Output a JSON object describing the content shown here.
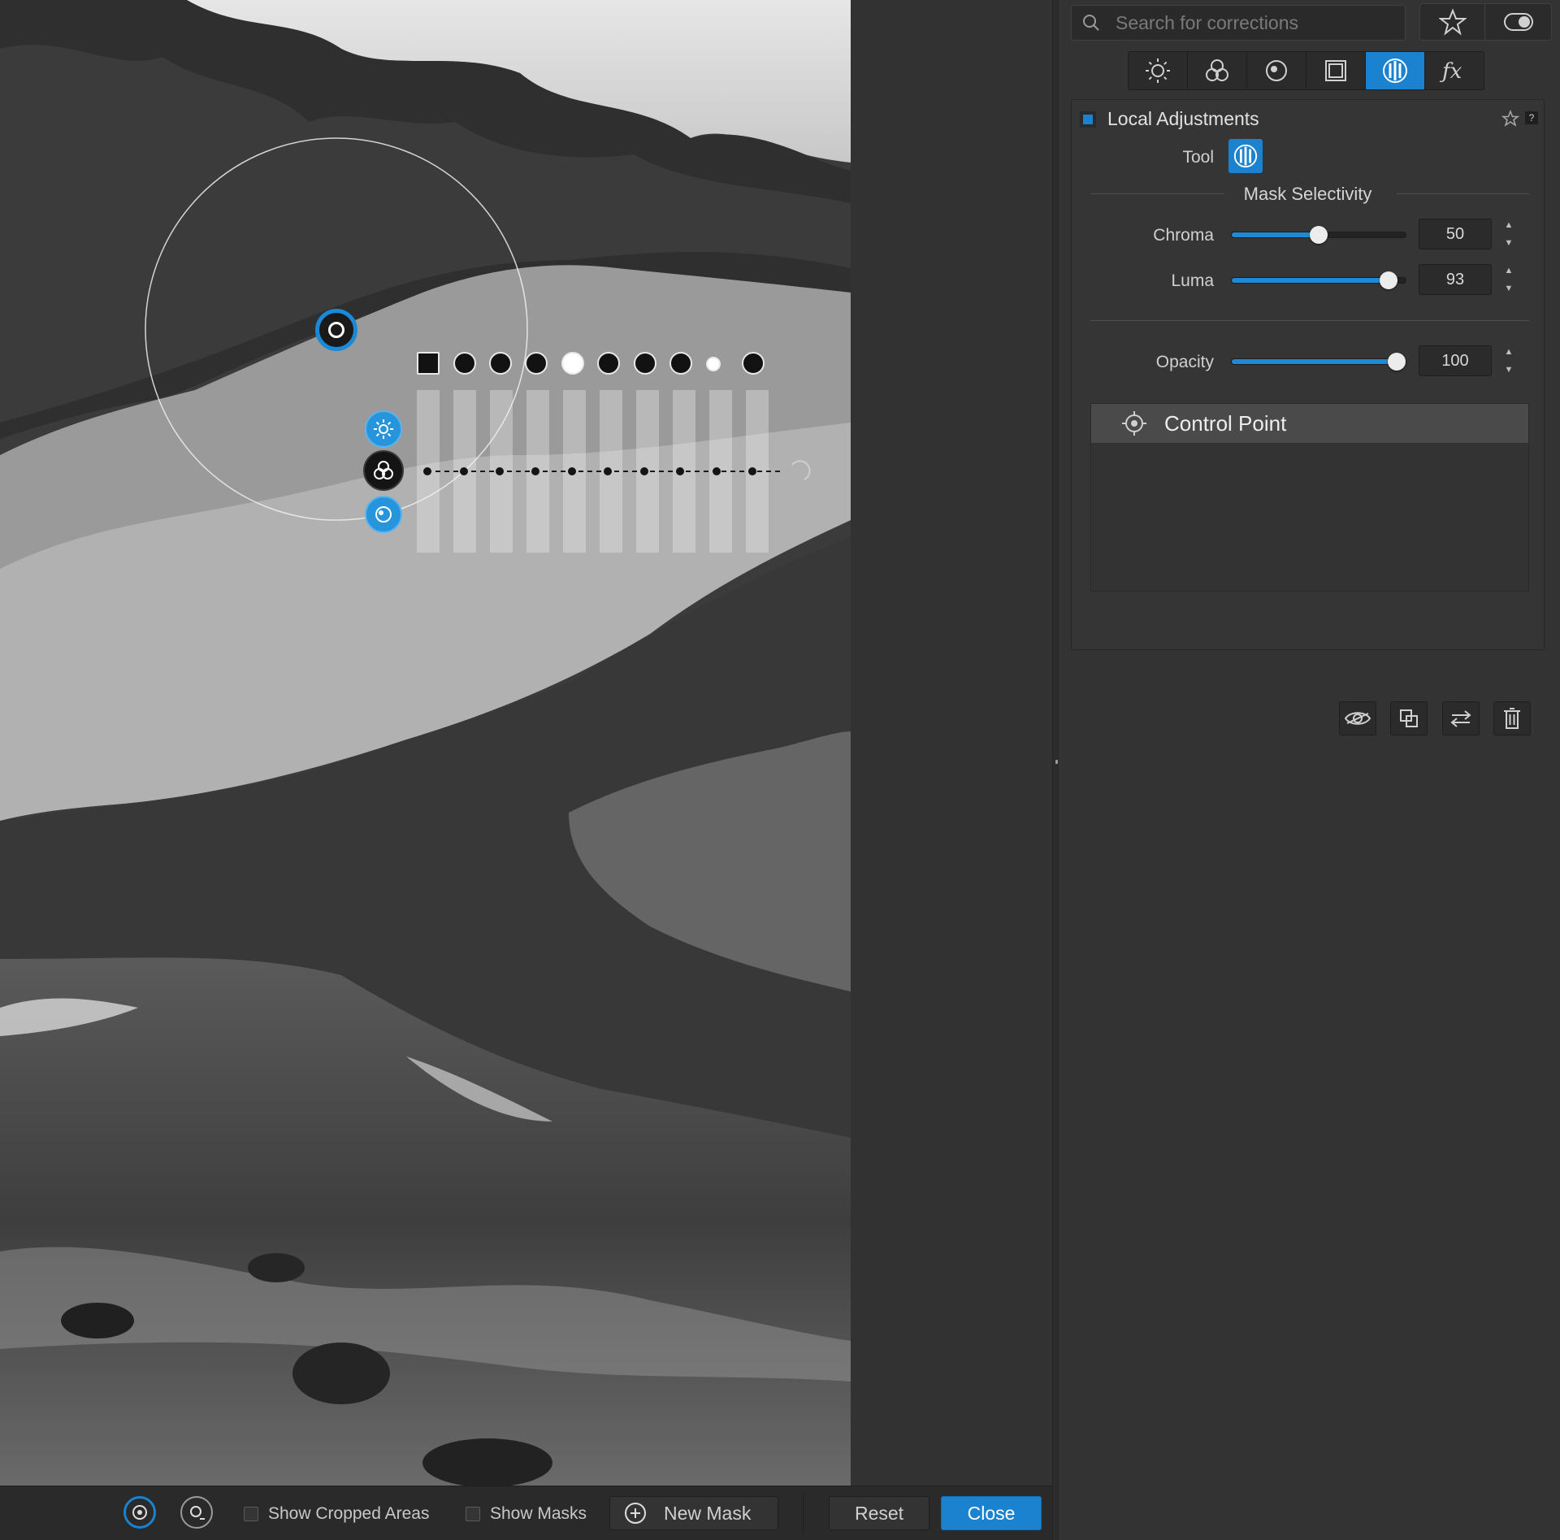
{
  "search": {
    "placeholder": "Search for corrections"
  },
  "tabs": [
    {
      "name": "light-tab",
      "icon": "sun-icon",
      "active": false
    },
    {
      "name": "color-tab",
      "icon": "color-circles-icon",
      "active": false
    },
    {
      "name": "detail-tab",
      "icon": "detail-icon",
      "active": false
    },
    {
      "name": "geometry-tab",
      "icon": "geometry-icon",
      "active": false
    },
    {
      "name": "local-tab",
      "icon": "local-adjustments-icon",
      "active": true
    },
    {
      "name": "effects-tab",
      "icon": "fx-icon",
      "active": false
    }
  ],
  "local_adjustments": {
    "title": "Local Adjustments",
    "enabled": true,
    "tool_label": "Tool",
    "mask_selectivity_title": "Mask Selectivity",
    "chroma": {
      "label": "Chroma",
      "value": "50",
      "fraction": 0.5
    },
    "luma": {
      "label": "Luma",
      "value": "93",
      "fraction": 0.9
    },
    "opacity": {
      "label": "Opacity",
      "value": "100",
      "fraction": 0.95
    },
    "control_point_label": "Control Point"
  },
  "bottom_bar": {
    "show_cropped_label": "Show Cropped Areas",
    "show_masks_label": "Show Masks",
    "new_mask_label": "New Mask",
    "reset_label": "Reset",
    "close_label": "Close"
  },
  "colors": {
    "accent": "#1a82cf",
    "panel_bg": "#333334"
  }
}
